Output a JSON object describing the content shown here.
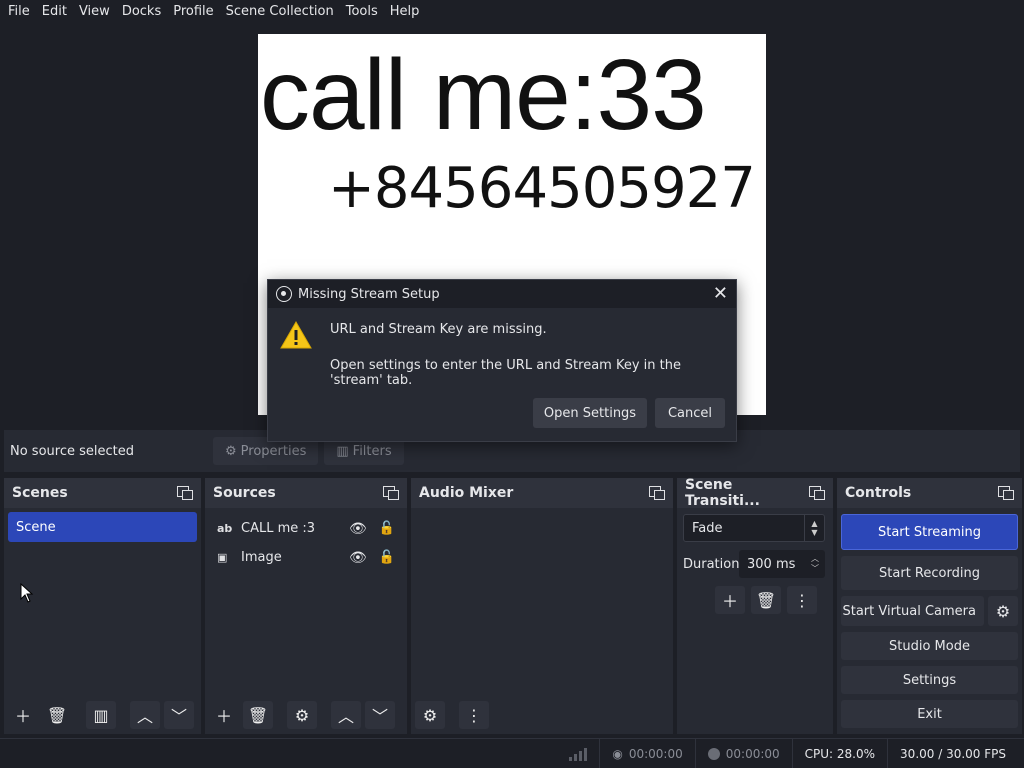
{
  "menu": [
    "File",
    "Edit",
    "View",
    "Docks",
    "Profile",
    "Scene Collection",
    "Tools",
    "Help"
  ],
  "preview": {
    "big_text": "call me:33",
    "phone_text": "+84564505927"
  },
  "source_toolbar": {
    "no_source": "No source selected",
    "properties": "Properties",
    "filters": "Filters"
  },
  "docks": {
    "scenes": {
      "title": "Scenes",
      "items": [
        "Scene"
      ]
    },
    "sources": {
      "title": "Sources",
      "items": [
        {
          "icon": "text-icon",
          "name": "CALL me :3"
        },
        {
          "icon": "image-icon",
          "name": "Image"
        }
      ]
    },
    "audio_mixer": {
      "title": "Audio Mixer"
    },
    "transitions": {
      "title": "Scene Transiti...",
      "selected": "Fade",
      "duration_label": "Duration",
      "duration_value": "300 ms"
    },
    "controls": {
      "title": "Controls",
      "start_streaming": "Start Streaming",
      "start_recording": "Start Recording",
      "virtual_camera": "Start Virtual Camera",
      "studio_mode": "Studio Mode",
      "settings": "Settings",
      "exit": "Exit"
    }
  },
  "status": {
    "stream_time": "00:00:00",
    "record_time": "00:00:00",
    "cpu": "CPU: 28.0%",
    "fps": "30.00 / 30.00 FPS"
  },
  "dialog": {
    "title": "Missing Stream Setup",
    "line1": "URL and Stream Key are missing.",
    "line2": "Open settings to enter the URL and Stream Key in the 'stream' tab.",
    "open_settings": "Open Settings",
    "cancel": "Cancel"
  },
  "colors": {
    "background": "#1d1f26",
    "dock": "#272a33",
    "accent": "#2c47b8",
    "warning": "#f5c518"
  }
}
